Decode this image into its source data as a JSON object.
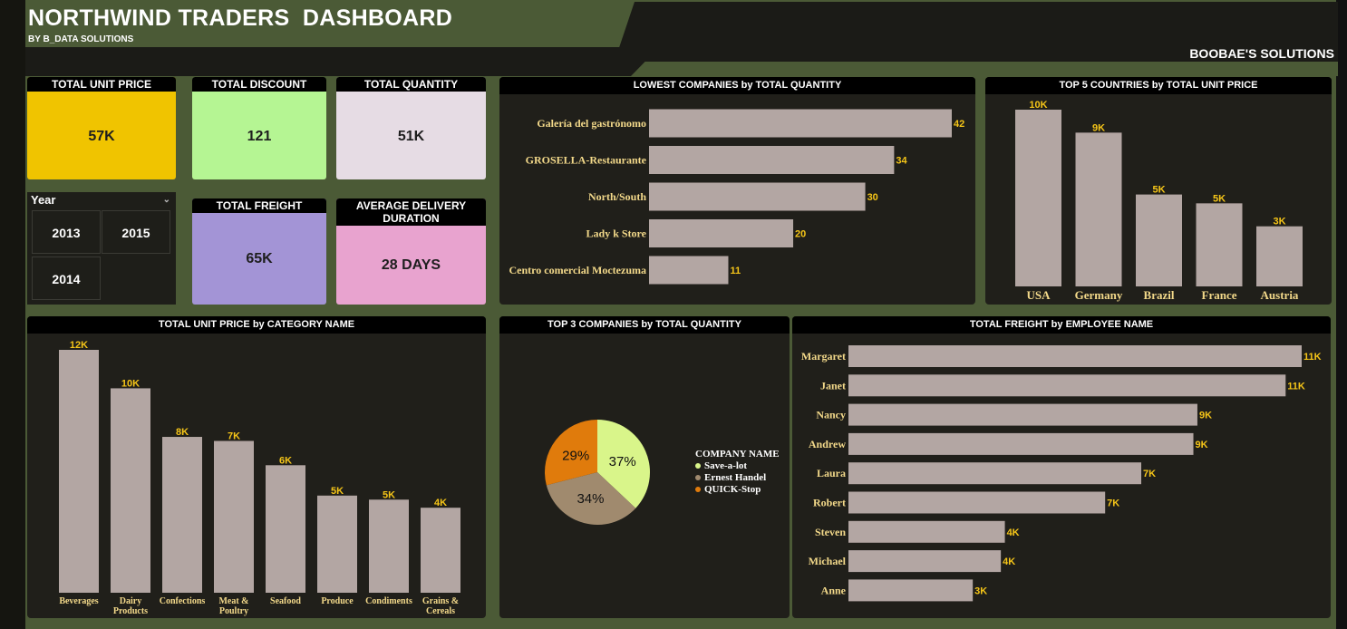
{
  "header": {
    "title": "NORTHWIND TRADERS  DASHBOARD",
    "subtitle": "BY B_DATA SOLUTIONS",
    "brand": "BOOBAE'S SOLUTIONS"
  },
  "kpis": {
    "total_unit_price": {
      "label": "TOTAL UNIT PRICE",
      "value": "57K",
      "color": "#f0c400"
    },
    "total_discount": {
      "label": "TOTAL DISCOUNT",
      "value": "121",
      "color": "#b5f593"
    },
    "total_quantity": {
      "label": "TOTAL QUANTITY",
      "value": "51K",
      "color": "#e6dce4"
    },
    "total_freight": {
      "label": "TOTAL FREIGHT",
      "value": "65K",
      "color": "#a394d6"
    },
    "avg_delivery": {
      "label_line1": "AVERAGE DELIVERY",
      "label_line2": "DURATION",
      "value": "28 DAYS",
      "color": "#e8a3cf"
    }
  },
  "year_slicer": {
    "title": "Year",
    "options": [
      "2013",
      "2015",
      "2014"
    ]
  },
  "colors": {
    "bar": "#b3a6a3",
    "value_label": "#f5c518",
    "axis_label": "#f3d98a",
    "panel_bg": "#201f1a",
    "background": "#4b5a36"
  },
  "chart_data": [
    {
      "id": "lowest_companies",
      "type": "bar",
      "orientation": "horizontal",
      "title": "LOWEST COMPANIES by TOTAL QUANTITY",
      "categories": [
        "Galería del gastrónomo",
        "GROSELLA-Restaurante",
        "North/South",
        "Lady k Store",
        "Centro comercial Moctezuma"
      ],
      "values": [
        42,
        34,
        30,
        20,
        11
      ],
      "labels": [
        "42",
        "34",
        "30",
        "20",
        "11"
      ],
      "xlim": [
        0,
        42
      ]
    },
    {
      "id": "top5_countries",
      "type": "bar",
      "orientation": "vertical",
      "title": "TOP 5 COUNTRIES by TOTAL UNIT PRICE",
      "categories": [
        "USA",
        "Germany",
        "Brazil",
        "France",
        "Austria"
      ],
      "values": [
        10,
        8.7,
        5.2,
        4.7,
        3.4
      ],
      "labels": [
        "10K",
        "9K",
        "5K",
        "5K",
        "3K"
      ],
      "ylim": [
        0,
        10
      ]
    },
    {
      "id": "unit_price_by_category",
      "type": "bar",
      "orientation": "vertical",
      "title": "TOTAL UNIT PRICE by CATEGORY NAME",
      "categories": [
        "Beverages",
        "Dairy Products",
        "Confections",
        "Meat & Poultry",
        "Seafood",
        "Produce",
        "Condiments",
        "Grains & Cereals"
      ],
      "values": [
        12,
        10.1,
        7.7,
        7.5,
        6.3,
        4.8,
        4.6,
        4.2
      ],
      "labels": [
        "12K",
        "10K",
        "8K",
        "7K",
        "6K",
        "5K",
        "5K",
        "4K"
      ],
      "ylim": [
        0,
        12
      ]
    },
    {
      "id": "top3_companies",
      "type": "pie",
      "title": "TOP 3 COMPANIES by TOTAL QUANTITY",
      "legend_title": "COMPANY NAME",
      "categories": [
        "Save-a-lot",
        "Ernest Handel",
        "QUICK-Stop"
      ],
      "values": [
        37,
        34,
        29
      ],
      "labels": [
        "37%",
        "34%",
        "29%"
      ],
      "colors": [
        "#d9f58a",
        "#a08a6e",
        "#e07b0c"
      ]
    },
    {
      "id": "freight_by_employee",
      "type": "bar",
      "orientation": "horizontal",
      "title": "TOTAL FREIGHT by EMPLOYEE NAME",
      "categories": [
        "Margaret",
        "Janet",
        "Nancy",
        "Andrew",
        "Laura",
        "Robert",
        "Steven",
        "Michael",
        "Anne"
      ],
      "values": [
        11.3,
        10.9,
        8.7,
        8.6,
        7.3,
        6.4,
        3.9,
        3.8,
        3.1
      ],
      "labels": [
        "11K",
        "11K",
        "9K",
        "9K",
        "7K",
        "7K",
        "4K",
        "4K",
        "3K"
      ],
      "xlim": [
        0,
        11.3
      ]
    }
  ]
}
